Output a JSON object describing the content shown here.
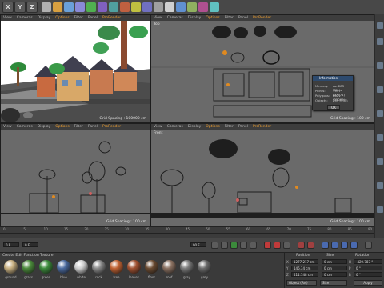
{
  "toolbar": {
    "axis_buttons": [
      "X",
      "Y",
      "Z"
    ],
    "icon_colors": [
      "#b0b0b0",
      "#d8a040",
      "#6aa0d8",
      "#8a8ad8",
      "#50b050",
      "#8060c0",
      "#50a0a0",
      "#c06040",
      "#c0c040",
      "#7070c0",
      "#a0a0a0",
      "#d0d0d0",
      "#6090d0",
      "#90b060",
      "#b05090",
      "#60c0c0"
    ]
  },
  "viewports": {
    "perspective": {
      "menu": [
        "View",
        "Cameras",
        "Display",
        "Options",
        "Filter",
        "Panel",
        "ProRender"
      ],
      "grid_label": "Grid Spacing : 100000 cm"
    },
    "top": {
      "menu": [
        "View",
        "Cameras",
        "Display",
        "Options",
        "Filter",
        "Panel",
        "ProRender"
      ],
      "title": "Top",
      "grid_label": "Grid Spacing : 100 cm"
    },
    "right": {
      "menu": [
        "View",
        "Cameras",
        "Display",
        "Options",
        "Filter",
        "Panel",
        "ProRender"
      ],
      "grid_label": "Grid Spacing : 100 cm"
    },
    "front": {
      "menu": [
        "View",
        "Cameras",
        "Display",
        "Options",
        "Filter",
        "Panel",
        "ProRender"
      ],
      "title": "Front",
      "grid_label": "Grid Spacing : 100 cm"
    }
  },
  "info_popup": {
    "title": "Information",
    "rows": [
      {
        "label": "Memory:",
        "value": "ca. 283 MByte"
      },
      {
        "label": "Points:",
        "value": "7937 (37771)"
      },
      {
        "label": "Polygons:",
        "value": "6621 (35069)"
      },
      {
        "label": "Objects:",
        "value": "255 (735)"
      }
    ],
    "ok_label": "OK"
  },
  "timeline": {
    "ticks": [
      "0",
      "5",
      "10",
      "15",
      "20",
      "25",
      "30",
      "35",
      "40",
      "45",
      "50",
      "55",
      "60",
      "65",
      "70",
      "75",
      "80",
      "85",
      "90"
    ],
    "frame_start": "0 F",
    "frame_current": "0 F",
    "frame_end": "90 F"
  },
  "materials": {
    "header": "Create  Edit  Function  Texture",
    "items": [
      {
        "label": "ground",
        "color": "#c8b080"
      },
      {
        "label": "grass",
        "color": "#4a8a3a"
      },
      {
        "label": "green",
        "color": "#3a8a3a"
      },
      {
        "label": "blue",
        "color": "#4a6aa0"
      },
      {
        "label": "white",
        "color": "#d0d0d0"
      },
      {
        "label": "rock",
        "color": "#8a8a8a"
      },
      {
        "label": "tree",
        "color": "#c06030"
      },
      {
        "label": "leaves",
        "color": "#a05030"
      },
      {
        "label": "floor",
        "color": "#6a4a30"
      },
      {
        "label": "roof",
        "color": "#8a7060"
      },
      {
        "label": "gray",
        "color": "#7a7a7a"
      },
      {
        "label": "grey",
        "color": "#6a6a6a"
      }
    ]
  },
  "coordinates": {
    "headers": [
      "Position",
      "Size",
      "Rotation"
    ],
    "rows": [
      {
        "axis": "X",
        "position": "1277.217 cm",
        "size": "0 cm",
        "rot_axis": "H",
        "rotation": "-429.787 °"
      },
      {
        "axis": "Y",
        "position": "146.34 cm",
        "size": "0 cm",
        "rot_axis": "P",
        "rotation": "0 °"
      },
      {
        "axis": "Z",
        "position": "411.148 cm",
        "size": "0 cm",
        "rot_axis": "B",
        "rotation": "0 °"
      }
    ],
    "mode": "Object (Rel)",
    "size_mode": "Size",
    "apply": "Apply"
  }
}
